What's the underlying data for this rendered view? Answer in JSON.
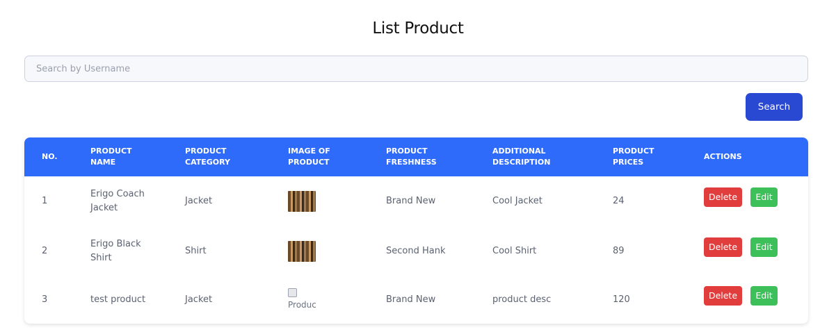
{
  "page": {
    "title": "List Product"
  },
  "search": {
    "placeholder": "Search by Username",
    "value": "",
    "button_label": "Search"
  },
  "table": {
    "headers": [
      "NO.",
      "PRODUCT NAME",
      "PRODUCT CATEGORY",
      "IMAGE OF PRODUCT",
      "PRODUCT FRESHNESS",
      "ADDITIONAL DESCRIPTION",
      "PRODUCT PRICES",
      "ACTIONS"
    ],
    "rows": [
      {
        "no": "1",
        "name": "Erigo Coach Jacket",
        "category": "Jacket",
        "image": "product-photo",
        "freshness": "Brand New",
        "description": "Cool Jacket",
        "price": "24",
        "delete_label": "Delete",
        "edit_label": "Edit"
      },
      {
        "no": "2",
        "name": "Erigo Black Shirt",
        "category": "Shirt",
        "image": "product-photo",
        "freshness": "Second Hank",
        "description": "Cool Shirt",
        "price": "89",
        "delete_label": "Delete",
        "edit_label": "Edit"
      },
      {
        "no": "3",
        "name": "test product",
        "category": "Jacket",
        "image_alt": "Produc",
        "freshness": "Brand New",
        "description": "product desc",
        "price": "120",
        "delete_label": "Delete",
        "edit_label": "Edit"
      }
    ]
  },
  "colors": {
    "header_bg": "#2f6bfb",
    "search_button": "#2a49d3",
    "delete_button": "#e23d3d",
    "edit_button": "#3dbf5a"
  }
}
